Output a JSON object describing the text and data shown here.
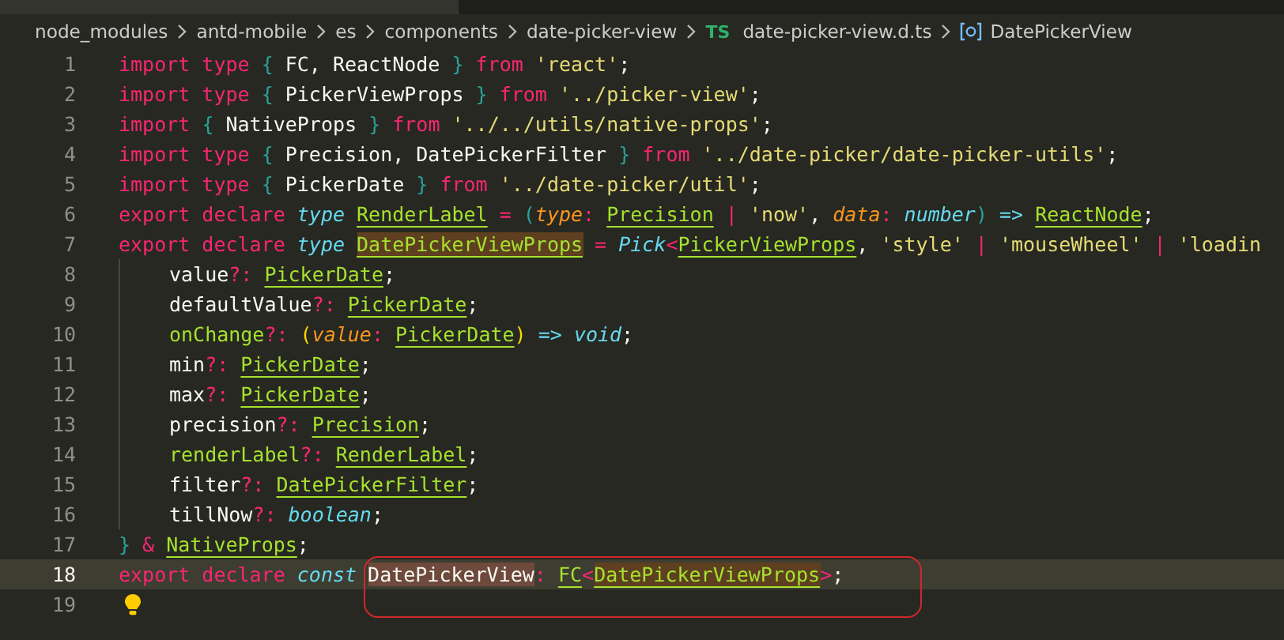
{
  "breadcrumb": [
    {
      "label": "node_modules",
      "kind": "folder"
    },
    {
      "label": "antd-mobile",
      "kind": "folder"
    },
    {
      "label": "es",
      "kind": "folder"
    },
    {
      "label": "components",
      "kind": "folder"
    },
    {
      "label": "date-picker-view",
      "kind": "folder"
    },
    {
      "label": "date-picker-view.d.ts",
      "kind": "file",
      "badge": "TS"
    },
    {
      "label": "DatePickerView",
      "kind": "symbol"
    }
  ],
  "lines": [
    {
      "number": "1",
      "kind": "plain",
      "tokens": [
        {
          "t": "import type ",
          "kind": "kw"
        },
        {
          "t": "{",
          "kind": "brace"
        },
        {
          "t": " FC, ReactNode ",
          "kind": "id"
        },
        {
          "t": "}",
          "kind": "brace"
        },
        {
          "t": " from ",
          "kind": "kw"
        },
        {
          "t": "'react'",
          "kind": "str"
        },
        {
          "t": ";",
          "kind": "id"
        }
      ]
    },
    {
      "number": "2",
      "kind": "plain",
      "tokens": [
        {
          "t": "import type ",
          "kind": "kw"
        },
        {
          "t": "{",
          "kind": "brace"
        },
        {
          "t": " PickerViewProps ",
          "kind": "id"
        },
        {
          "t": "}",
          "kind": "brace"
        },
        {
          "t": " from ",
          "kind": "kw"
        },
        {
          "t": "'../picker-view'",
          "kind": "str"
        },
        {
          "t": ";",
          "kind": "id"
        }
      ]
    },
    {
      "number": "3",
      "kind": "plain",
      "tokens": [
        {
          "t": "import ",
          "kind": "kw"
        },
        {
          "t": "{",
          "kind": "brace"
        },
        {
          "t": " NativeProps ",
          "kind": "id"
        },
        {
          "t": "}",
          "kind": "brace"
        },
        {
          "t": " from ",
          "kind": "kw"
        },
        {
          "t": "'../../utils/native-props'",
          "kind": "str"
        },
        {
          "t": ";",
          "kind": "id"
        }
      ]
    },
    {
      "number": "4",
      "kind": "plain",
      "tokens": [
        {
          "t": "import type ",
          "kind": "kw"
        },
        {
          "t": "{",
          "kind": "brace"
        },
        {
          "t": " Precision, DatePickerFilter ",
          "kind": "id"
        },
        {
          "t": "}",
          "kind": "brace"
        },
        {
          "t": " from ",
          "kind": "kw"
        },
        {
          "t": "'../date-picker/date-picker-utils'",
          "kind": "str"
        },
        {
          "t": ";",
          "kind": "id"
        }
      ]
    },
    {
      "number": "5",
      "kind": "plain",
      "tokens": [
        {
          "t": "import type ",
          "kind": "kw"
        },
        {
          "t": "{",
          "kind": "brace"
        },
        {
          "t": " PickerDate ",
          "kind": "id"
        },
        {
          "t": "}",
          "kind": "brace"
        },
        {
          "t": " from ",
          "kind": "kw"
        },
        {
          "t": "'../date-picker/util'",
          "kind": "str"
        },
        {
          "t": ";",
          "kind": "id"
        }
      ]
    },
    {
      "number": "6",
      "kind": "plain",
      "tokens": [
        {
          "t": "export declare ",
          "kind": "kw"
        },
        {
          "t": "type ",
          "kind": "store"
        },
        {
          "t": "RenderLabel",
          "kind": "ref"
        },
        {
          "t": " = ",
          "kind": "op"
        },
        {
          "t": "(",
          "kind": "brace"
        },
        {
          "t": "type",
          "kind": "param"
        },
        {
          "t": ": ",
          "kind": "op"
        },
        {
          "t": "Precision",
          "kind": "ref"
        },
        {
          "t": " | ",
          "kind": "op"
        },
        {
          "t": "'now'",
          "kind": "str"
        },
        {
          "t": ", ",
          "kind": "id"
        },
        {
          "t": "data",
          "kind": "param"
        },
        {
          "t": ": ",
          "kind": "op"
        },
        {
          "t": "number",
          "kind": "store"
        },
        {
          "t": ")",
          "kind": "brace"
        },
        {
          "t": " => ",
          "kind": "arrow"
        },
        {
          "t": "ReactNode",
          "kind": "ref"
        },
        {
          "t": ";",
          "kind": "id"
        }
      ]
    },
    {
      "number": "7",
      "kind": "plain",
      "tokens": [
        {
          "t": "export declare ",
          "kind": "kw"
        },
        {
          "t": "type ",
          "kind": "store"
        },
        {
          "t": "DatePickerViewProps",
          "kind": "ref-hl"
        },
        {
          "t": " = ",
          "kind": "op"
        },
        {
          "t": "Pick",
          "kind": "store"
        },
        {
          "t": "<",
          "kind": "op"
        },
        {
          "t": "PickerViewProps",
          "kind": "ref"
        },
        {
          "t": ", ",
          "kind": "id"
        },
        {
          "t": "'style'",
          "kind": "str"
        },
        {
          "t": " | ",
          "kind": "op"
        },
        {
          "t": "'mouseWheel'",
          "kind": "str"
        },
        {
          "t": " | ",
          "kind": "op"
        },
        {
          "t": "'loadin",
          "kind": "str"
        }
      ]
    },
    {
      "number": "8",
      "kind": "nested",
      "tokens": [
        {
          "t": "value",
          "kind": "id"
        },
        {
          "t": "?: ",
          "kind": "op"
        },
        {
          "t": "PickerDate",
          "kind": "ref"
        },
        {
          "t": ";",
          "kind": "id"
        }
      ]
    },
    {
      "number": "9",
      "kind": "nested",
      "tokens": [
        {
          "t": "defaultValue",
          "kind": "id"
        },
        {
          "t": "?: ",
          "kind": "op"
        },
        {
          "t": "PickerDate",
          "kind": "ref"
        },
        {
          "t": ";",
          "kind": "id"
        }
      ]
    },
    {
      "number": "10",
      "kind": "nested",
      "tokens": [
        {
          "t": "onChange",
          "kind": "fn"
        },
        {
          "t": "?: ",
          "kind": "op"
        },
        {
          "t": "(",
          "kind": "brace2"
        },
        {
          "t": "value",
          "kind": "param"
        },
        {
          "t": ": ",
          "kind": "op"
        },
        {
          "t": "PickerDate",
          "kind": "ref"
        },
        {
          "t": ")",
          "kind": "brace2"
        },
        {
          "t": " => ",
          "kind": "arrow"
        },
        {
          "t": "void",
          "kind": "store"
        },
        {
          "t": ";",
          "kind": "id"
        }
      ]
    },
    {
      "number": "11",
      "kind": "nested",
      "tokens": [
        {
          "t": "min",
          "kind": "id"
        },
        {
          "t": "?: ",
          "kind": "op"
        },
        {
          "t": "PickerDate",
          "kind": "ref"
        },
        {
          "t": ";",
          "kind": "id"
        }
      ]
    },
    {
      "number": "12",
      "kind": "nested",
      "tokens": [
        {
          "t": "max",
          "kind": "id"
        },
        {
          "t": "?: ",
          "kind": "op"
        },
        {
          "t": "PickerDate",
          "kind": "ref"
        },
        {
          "t": ";",
          "kind": "id"
        }
      ]
    },
    {
      "number": "13",
      "kind": "nested",
      "tokens": [
        {
          "t": "precision",
          "kind": "id"
        },
        {
          "t": "?: ",
          "kind": "op"
        },
        {
          "t": "Precision",
          "kind": "ref"
        },
        {
          "t": ";",
          "kind": "id"
        }
      ]
    },
    {
      "number": "14",
      "kind": "nested",
      "tokens": [
        {
          "t": "renderLabel",
          "kind": "fn"
        },
        {
          "t": "?: ",
          "kind": "op"
        },
        {
          "t": "RenderLabel",
          "kind": "ref"
        },
        {
          "t": ";",
          "kind": "id"
        }
      ]
    },
    {
      "number": "15",
      "kind": "nested",
      "tokens": [
        {
          "t": "filter",
          "kind": "id"
        },
        {
          "t": "?: ",
          "kind": "op"
        },
        {
          "t": "DatePickerFilter",
          "kind": "ref"
        },
        {
          "t": ";",
          "kind": "id"
        }
      ]
    },
    {
      "number": "16",
      "kind": "nested",
      "tokens": [
        {
          "t": "tillNow",
          "kind": "id"
        },
        {
          "t": "?: ",
          "kind": "op"
        },
        {
          "t": "boolean",
          "kind": "store"
        },
        {
          "t": ";",
          "kind": "id"
        }
      ]
    },
    {
      "number": "17",
      "kind": "plain",
      "tokens": [
        {
          "t": "}",
          "kind": "brace"
        },
        {
          "t": " & ",
          "kind": "op"
        },
        {
          "t": "NativeProps",
          "kind": "ref"
        },
        {
          "t": ";",
          "kind": "id"
        }
      ]
    },
    {
      "number": "18",
      "kind": "current",
      "tokens": [
        {
          "t": "export declare ",
          "kind": "kw"
        },
        {
          "t": "const ",
          "kind": "store"
        }
      ],
      "boxed": [
        {
          "t": "DatePickerView",
          "kind": "id-hl"
        },
        {
          "t": ": ",
          "kind": "op"
        },
        {
          "t": "FC",
          "kind": "ref"
        },
        {
          "t": "<",
          "kind": "op"
        },
        {
          "t": "DatePickerViewProps",
          "kind": "ref-hl"
        },
        {
          "t": ">",
          "kind": "op"
        },
        {
          "t": ";",
          "kind": "id"
        }
      ]
    },
    {
      "number": "19",
      "kind": "hint"
    }
  ]
}
